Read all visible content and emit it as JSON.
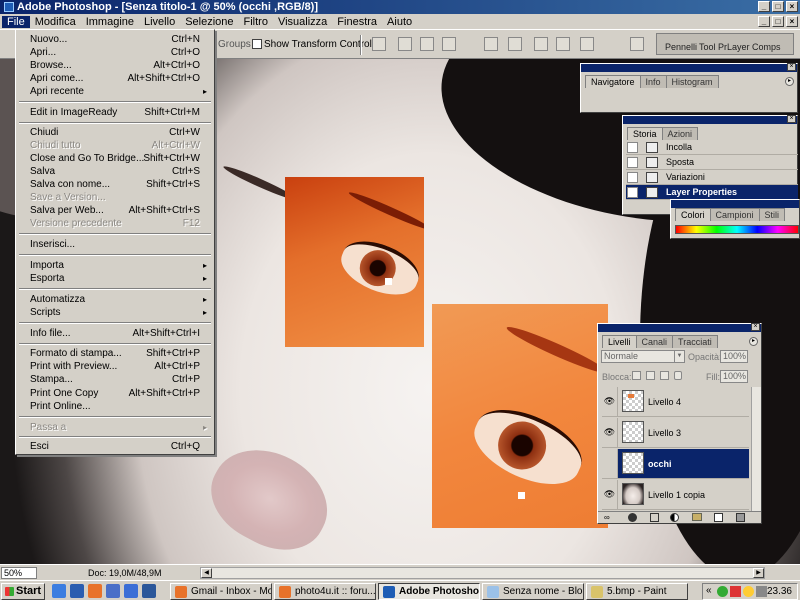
{
  "window": {
    "title": "Adobe Photoshop - [Senza titolo-1 @ 50% (occhi ,RGB/8)]",
    "buttons": [
      "_",
      "□",
      "×"
    ]
  },
  "menubar": [
    "File",
    "Modifica",
    "Immagine",
    "Livello",
    "Selezione",
    "Filtro",
    "Visualizza",
    "Finestra",
    "Aiuto"
  ],
  "options_bar": {
    "groups_label": "Groups",
    "show_transform_label": "Show Transform Controls"
  },
  "palette_well": {
    "tabs": [
      "Pennelli",
      "Tool Pr",
      "Layer Comps"
    ]
  },
  "file_menu": {
    "items": [
      {
        "label": "Nuovo...",
        "shortcut": "Ctrl+N"
      },
      {
        "label": "Apri...",
        "shortcut": "Ctrl+O"
      },
      {
        "label": "Browse...",
        "shortcut": "Alt+Ctrl+O"
      },
      {
        "label": "Apri come...",
        "shortcut": "Alt+Shift+Ctrl+O"
      },
      {
        "label": "Apri recente",
        "shortcut": "▸"
      },
      {
        "label": "Edit in ImageReady",
        "shortcut": "Shift+Ctrl+M"
      },
      {
        "label": "Chiudi",
        "shortcut": "Ctrl+W"
      },
      {
        "label": "Chiudi tutto",
        "shortcut": "Alt+Ctrl+W"
      },
      {
        "label": "Close and Go To Bridge...",
        "shortcut": "Shift+Ctrl+W"
      },
      {
        "label": "Salva",
        "shortcut": "Ctrl+S"
      },
      {
        "label": "Salva con nome...",
        "shortcut": "Shift+Ctrl+S"
      },
      {
        "label": "Save a Version...",
        "shortcut": ""
      },
      {
        "label": "Salva per Web...",
        "shortcut": "Alt+Shift+Ctrl+S"
      },
      {
        "label": "Versione precedente",
        "shortcut": "F12"
      },
      {
        "label": "Inserisci...",
        "shortcut": ""
      },
      {
        "label": "Importa",
        "shortcut": "▸"
      },
      {
        "label": "Esporta",
        "shortcut": "▸"
      },
      {
        "label": "Automatizza",
        "shortcut": "▸"
      },
      {
        "label": "Scripts",
        "shortcut": "▸"
      },
      {
        "label": "Info file...",
        "shortcut": "Alt+Shift+Ctrl+I"
      },
      {
        "label": "Formato di stampa...",
        "shortcut": "Shift+Ctrl+P"
      },
      {
        "label": "Print with Preview...",
        "shortcut": "Alt+Ctrl+P"
      },
      {
        "label": "Stampa...",
        "shortcut": "Ctrl+P"
      },
      {
        "label": "Print One Copy",
        "shortcut": "Alt+Shift+Ctrl+P"
      },
      {
        "label": "Print Online...",
        "shortcut": ""
      },
      {
        "label": "Passa a",
        "shortcut": "▸"
      },
      {
        "label": "Esci",
        "shortcut": "Ctrl+Q"
      }
    ]
  },
  "navigator_palette": {
    "tabs": [
      "Navigatore",
      "Info",
      "Histogram"
    ]
  },
  "history_palette": {
    "tabs": [
      "Storia",
      "Azioni"
    ],
    "rows": [
      "Incolla",
      "Sposta",
      "Variazioni",
      "Layer Properties"
    ]
  },
  "colors_palette": {
    "tabs": [
      "Colori",
      "Campioni",
      "Stili"
    ]
  },
  "layers_palette": {
    "tabs": [
      "Livelli",
      "Canali",
      "Tracciati"
    ],
    "blend_mode": "Normale",
    "opacity_label": "Opacità:",
    "opacity_value": "100%",
    "lock_label": "Blocca:",
    "fill_label": "Fill:",
    "fill_value": "100%",
    "layers": [
      {
        "name": "Livello 4"
      },
      {
        "name": "Livello 3"
      },
      {
        "name": "occhi"
      },
      {
        "name": "Livello 1 copia"
      }
    ]
  },
  "statusbar": {
    "zoom": "50%",
    "doc_info": "Doc: 19,0M/48,9M"
  },
  "taskbar": {
    "start_label": "Start",
    "tasks": [
      "Gmail - Inbox - Mo...",
      "photo4u.it :: foru...",
      "Adobe Photosho...",
      "Senza nome - Bloc...",
      "5.bmp - Paint"
    ],
    "clock": "23.36"
  },
  "colors": {
    "titlebar": "#0a246a",
    "face_orange": "#f08a3c",
    "dark_orange": "#b4300e"
  }
}
